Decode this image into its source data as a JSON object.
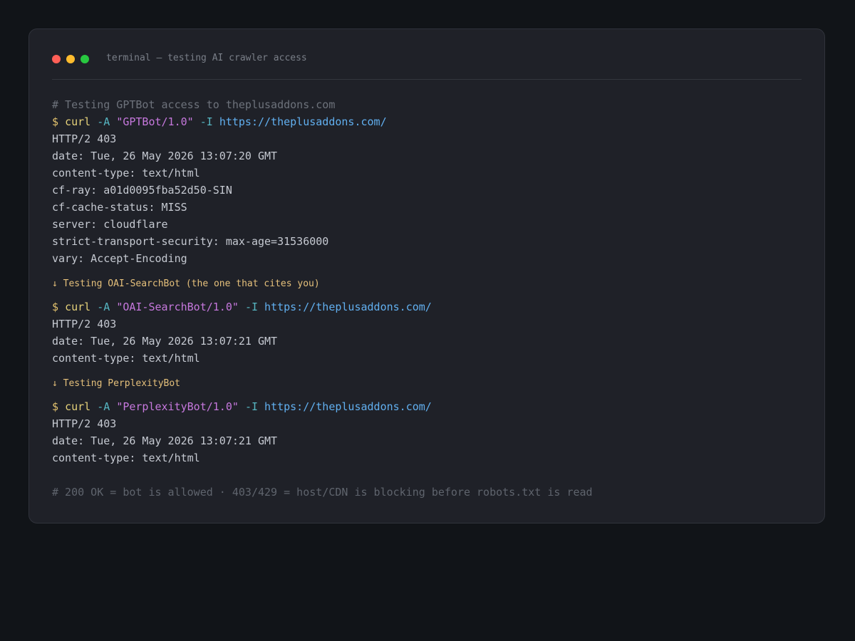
{
  "window": {
    "title": "terminal — testing AI crawler access",
    "traffic_lights": [
      "close",
      "minimize",
      "maximize"
    ]
  },
  "colors": {
    "background": "#111418",
    "panel": "#1f2128",
    "prompt": "#e2c26d",
    "flag": "#56b6c2",
    "string": "#c678dd",
    "url": "#61afef",
    "marker": "#e5c07b",
    "comment": "#6d727b"
  },
  "session": {
    "intro_comment": "# Testing GPTBot access to theplusaddons.com",
    "blocks": [
      {
        "prompt": "$",
        "cmd": "curl",
        "flag_a": "-A",
        "agent": "\"GPTBot/1.0\"",
        "flag_i": "-I",
        "url": "https://theplusaddons.com/",
        "output": [
          "HTTP/2 403",
          "date: Tue, 26 May 2026 13:07:20 GMT",
          "content-type: text/html",
          "cf-ray: a01d0095fba52d50-SIN",
          "cf-cache-status: MISS",
          "server: cloudflare",
          "strict-transport-security: max-age=31536000",
          "vary: Accept-Encoding"
        ]
      },
      {
        "marker": "↓ Testing OAI-SearchBot (the one that cites you)",
        "prompt": "$",
        "cmd": "curl",
        "flag_a": "-A",
        "agent": "\"OAI-SearchBot/1.0\"",
        "flag_i": "-I",
        "url": "https://theplusaddons.com/",
        "output": [
          "HTTP/2 403",
          "date: Tue, 26 May 2026 13:07:21 GMT",
          "content-type: text/html"
        ]
      },
      {
        "marker": "↓ Testing PerplexityBot",
        "prompt": "$",
        "cmd": "curl",
        "flag_a": "-A",
        "agent": "\"PerplexityBot/1.0\"",
        "flag_i": "-I",
        "url": "https://theplusaddons.com/",
        "output": [
          "HTTP/2 403",
          "date: Tue, 26 May 2026 13:07:21 GMT",
          "content-type: text/html"
        ]
      }
    ],
    "footer_comment": "# 200 OK = bot is allowed · 403/429 = host/CDN is blocking before robots.txt is read"
  }
}
